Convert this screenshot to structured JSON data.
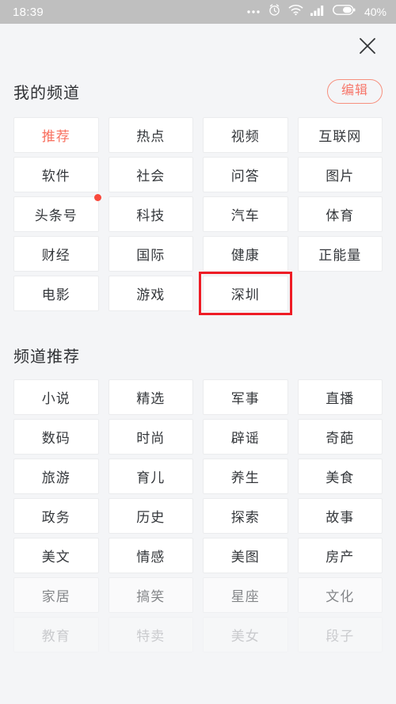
{
  "status_bar": {
    "time": "18:39",
    "battery_text": "40%",
    "icons": [
      "ellipsis-icon",
      "alarm-clock-icon",
      "wifi-icon",
      "signal-bars-icon",
      "battery-icon"
    ],
    "background": "#bfbfbf"
  },
  "header": {
    "close_icon": "close-icon"
  },
  "my_channels": {
    "title": "我的频道",
    "edit_label": "编辑",
    "accent_color": "#f8705f",
    "items": [
      {
        "label": "推荐",
        "selected": true,
        "badge": false
      },
      {
        "label": "热点",
        "selected": false,
        "badge": false
      },
      {
        "label": "视频",
        "selected": false,
        "badge": false
      },
      {
        "label": "互联网",
        "selected": false,
        "badge": false
      },
      {
        "label": "软件",
        "selected": false,
        "badge": false
      },
      {
        "label": "社会",
        "selected": false,
        "badge": false
      },
      {
        "label": "问答",
        "selected": false,
        "badge": false
      },
      {
        "label": "图片",
        "selected": false,
        "badge": false
      },
      {
        "label": "头条号",
        "selected": false,
        "badge": true
      },
      {
        "label": "科技",
        "selected": false,
        "badge": false
      },
      {
        "label": "汽车",
        "selected": false,
        "badge": false
      },
      {
        "label": "体育",
        "selected": false,
        "badge": false
      },
      {
        "label": "财经",
        "selected": false,
        "badge": false
      },
      {
        "label": "国际",
        "selected": false,
        "badge": false
      },
      {
        "label": "健康",
        "selected": false,
        "badge": false
      },
      {
        "label": "正能量",
        "selected": false,
        "badge": false
      },
      {
        "label": "电影",
        "selected": false,
        "badge": false
      },
      {
        "label": "游戏",
        "selected": false,
        "badge": false
      },
      {
        "label": "深圳",
        "selected": false,
        "badge": false,
        "highlighted": true
      }
    ]
  },
  "channel_recommend": {
    "title": "频道推荐",
    "items": [
      {
        "label": "小说",
        "fade": 0
      },
      {
        "label": "精选",
        "fade": 0
      },
      {
        "label": "军事",
        "fade": 0
      },
      {
        "label": "直播",
        "fade": 0
      },
      {
        "label": "数码",
        "fade": 0
      },
      {
        "label": "时尚",
        "fade": 0
      },
      {
        "label": "辟谣",
        "fade": 0
      },
      {
        "label": "奇葩",
        "fade": 0
      },
      {
        "label": "旅游",
        "fade": 0
      },
      {
        "label": "育儿",
        "fade": 0
      },
      {
        "label": "养生",
        "fade": 0
      },
      {
        "label": "美食",
        "fade": 0
      },
      {
        "label": "政务",
        "fade": 0
      },
      {
        "label": "历史",
        "fade": 0
      },
      {
        "label": "探索",
        "fade": 0
      },
      {
        "label": "故事",
        "fade": 0
      },
      {
        "label": "美文",
        "fade": 0
      },
      {
        "label": "情感",
        "fade": 0
      },
      {
        "label": "美图",
        "fade": 0
      },
      {
        "label": "房产",
        "fade": 0
      },
      {
        "label": "家居",
        "fade": 1
      },
      {
        "label": "搞笑",
        "fade": 1
      },
      {
        "label": "星座",
        "fade": 1
      },
      {
        "label": "文化",
        "fade": 1
      },
      {
        "label": "教育",
        "fade": 2
      },
      {
        "label": "特卖",
        "fade": 2
      },
      {
        "label": "美女",
        "fade": 2
      },
      {
        "label": "段子",
        "fade": 2
      }
    ]
  },
  "annotation": {
    "target_label": "深圳",
    "color": "#ee1c25"
  }
}
